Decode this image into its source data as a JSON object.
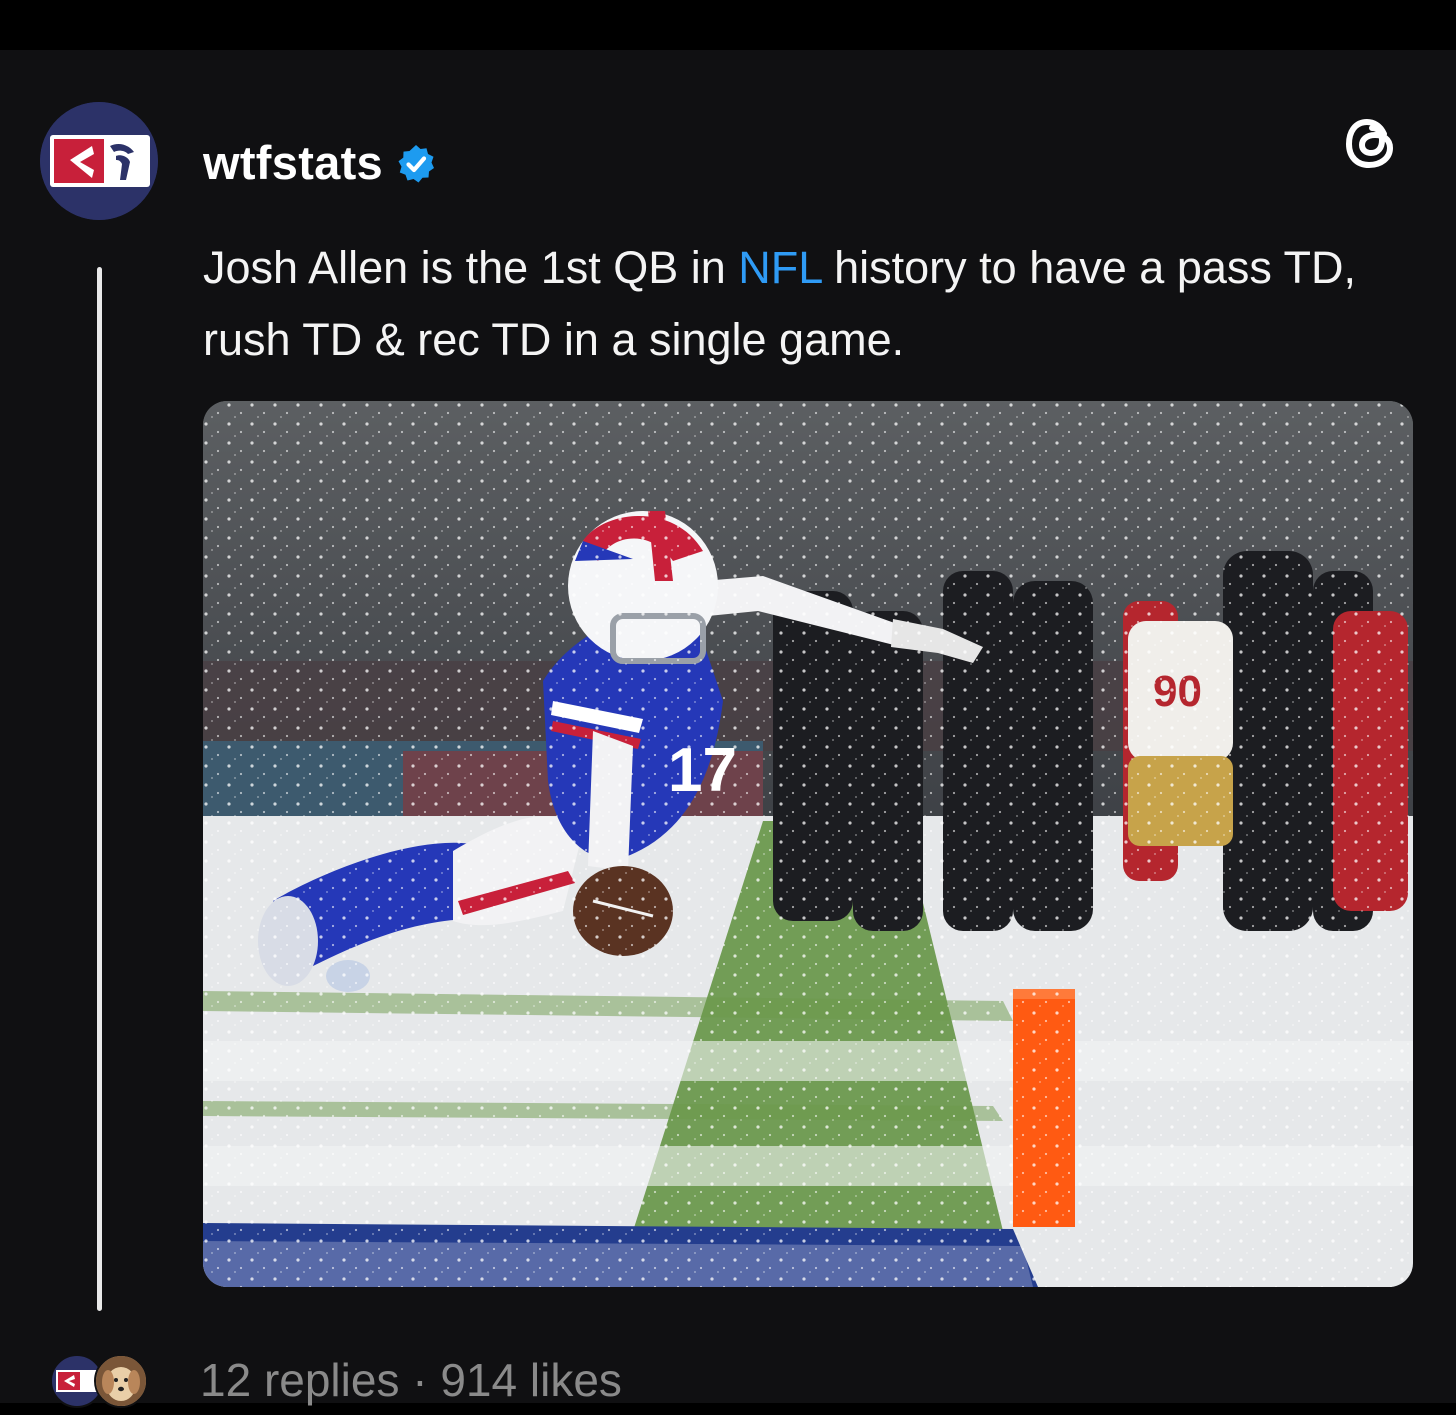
{
  "post": {
    "username": "wtfstats",
    "verified": true,
    "text_before_link": "Josh Allen is the 1st QB in ",
    "link_text": "NFL",
    "text_after_link": " history to have a pass TD, rush TD & rec TD in a single game.",
    "media": {
      "jersey_number": "17",
      "sideline_number": "90"
    }
  },
  "footer": {
    "replies": "12 replies",
    "separator": " · ",
    "likes": "914 likes"
  },
  "icons": {
    "logo": "threads-logo-icon",
    "verified": "verified-badge-icon"
  },
  "colors": {
    "background": "#101012",
    "link": "#2f9bf5",
    "verified": "#1d9bf0",
    "muted_text": "#8a8a8a"
  }
}
